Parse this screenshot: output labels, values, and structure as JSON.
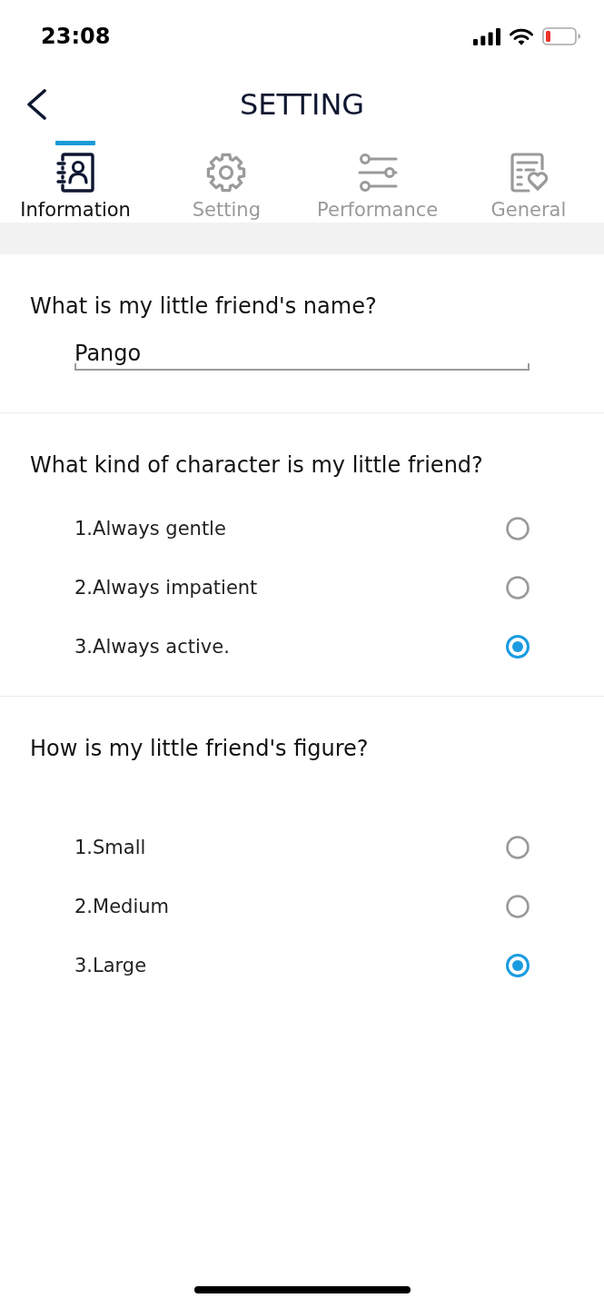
{
  "status_bar": {
    "time": "23:08"
  },
  "header": {
    "title": "SETTING"
  },
  "tabs": [
    {
      "label": "Information",
      "selected": true
    },
    {
      "label": "Setting",
      "selected": false
    },
    {
      "label": "Performance",
      "selected": false
    },
    {
      "label": "General",
      "selected": false
    }
  ],
  "questions": [
    {
      "kind": "text",
      "question": "What is my little friend's name?",
      "value": "Pango"
    },
    {
      "kind": "choice",
      "question": "What kind of character is my little friend?",
      "options": [
        {
          "label": "1.Always gentle",
          "selected": false
        },
        {
          "label": "2.Always impatient",
          "selected": false
        },
        {
          "label": "3.Always active.",
          "selected": true
        }
      ]
    },
    {
      "kind": "choice",
      "question": "How is my little friend's figure?",
      "options": [
        {
          "label": "1.Small",
          "selected": false
        },
        {
          "label": "2.Medium",
          "selected": false
        },
        {
          "label": "3.Large",
          "selected": true
        }
      ]
    }
  ]
}
